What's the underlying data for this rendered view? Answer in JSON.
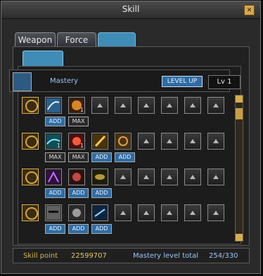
{
  "window": {
    "title": "Skill",
    "close_label": "✕"
  },
  "tabs": [
    {
      "label": "Weapon"
    },
    {
      "label": "Force"
    },
    {
      "label": ""
    }
  ],
  "mastery": {
    "label": "Mastery",
    "level_up_label": "LEVEL UP",
    "level": "Lv 1"
  },
  "rows": [
    {
      "skills": [
        {
          "icon": "wolf-slash-icon",
          "button": "ADD",
          "level": ""
        },
        {
          "icon": "fire-strike-icon",
          "button": "MAX",
          "level": "1"
        }
      ]
    },
    {
      "skills": [
        {
          "icon": "teal-wave-icon",
          "button": "MAX",
          "level": "1"
        },
        {
          "icon": "red-spin-icon",
          "button": "MAX",
          "level": "1"
        },
        {
          "icon": "golden-beam-icon",
          "button": "ADD",
          "level": ""
        },
        {
          "icon": "bronze-spiral-icon",
          "button": "ADD",
          "level": ""
        }
      ]
    },
    {
      "skills": [
        {
          "icon": "purple-claw-icon",
          "button": "ADD",
          "level": ""
        },
        {
          "icon": "red-spirit-icon",
          "button": "ADD",
          "level": ""
        },
        {
          "icon": "dark-eye-icon",
          "button": "ADD",
          "level": ""
        }
      ]
    },
    {
      "skills": [
        {
          "icon": "masked-face-icon",
          "button": "ADD",
          "level": ""
        },
        {
          "icon": "mirror-face-icon",
          "button": "ADD",
          "level": ""
        },
        {
          "icon": "blue-slash-icon",
          "button": "ADD",
          "level": ""
        }
      ]
    }
  ],
  "status": {
    "skill_point_label": "Skill point",
    "skill_point_value": "22599707",
    "mastery_total_label": "Mastery level total",
    "mastery_total_value": "254/330"
  },
  "colors": {
    "accent": "#3f8db7",
    "gold": "#d7b64a"
  }
}
